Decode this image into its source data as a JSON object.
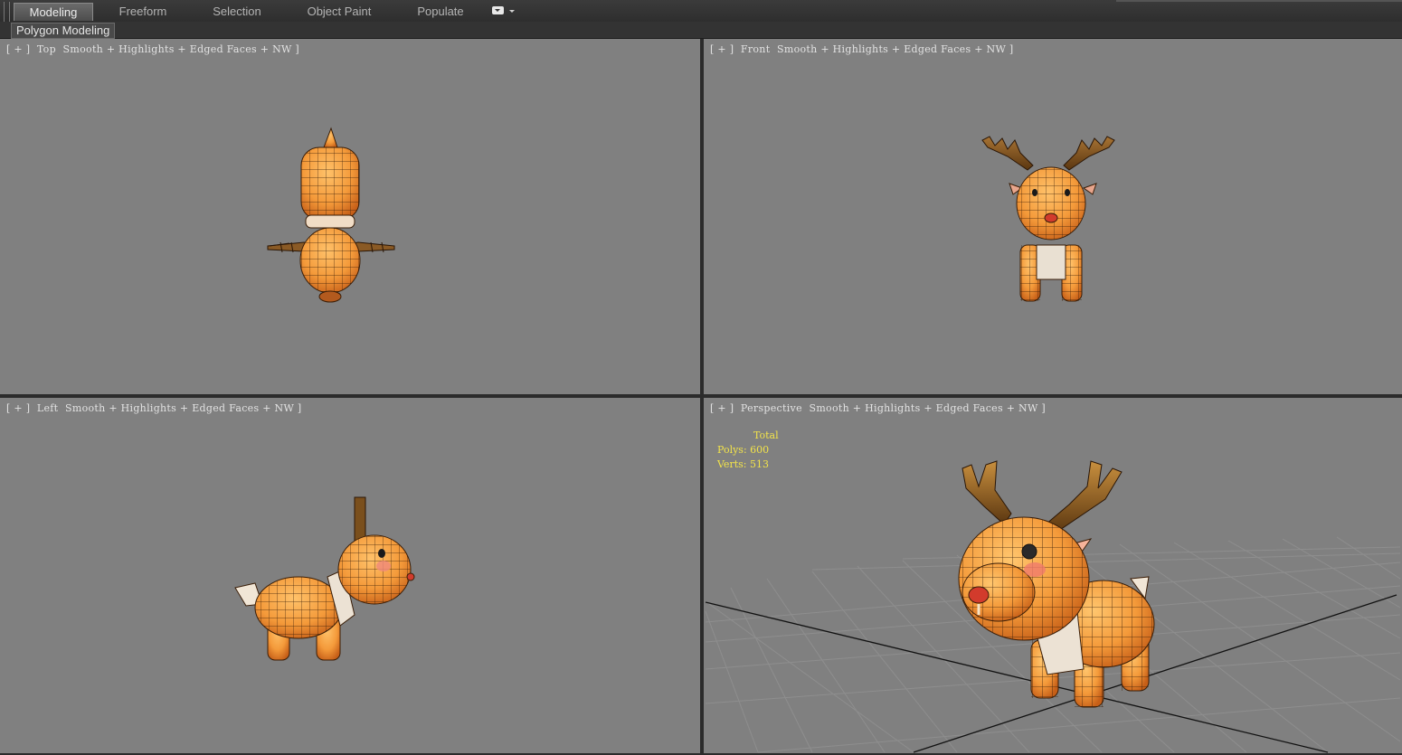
{
  "ribbon": {
    "tabs": [
      {
        "label": "Modeling",
        "active": true
      },
      {
        "label": "Freeform",
        "active": false
      },
      {
        "label": "Selection",
        "active": false
      },
      {
        "label": "Object Paint",
        "active": false
      },
      {
        "label": "Populate",
        "active": false
      }
    ]
  },
  "subribbon": {
    "panel_label": "Polygon Modeling"
  },
  "viewports": {
    "top": {
      "plus": "[ + ]",
      "view": "Top",
      "shading": "Smooth + Highlights + Edged Faces + NW ]"
    },
    "front": {
      "plus": "[ + ]",
      "view": "Front",
      "shading": "Smooth + Highlights + Edged Faces + NW ]"
    },
    "left": {
      "plus": "[ + ]",
      "view": "Left",
      "shading": "Smooth + Highlights + Edged Faces + NW ]"
    },
    "perspective": {
      "plus": "[ + ]",
      "view": "Perspective",
      "shading": "Smooth + Highlights + Edged Faces + NW ]",
      "stats": {
        "total_label": "Total",
        "polys": "Polys: 600",
        "verts": "Verts: 513"
      }
    }
  },
  "colors": {
    "viewport_bg": "#808080",
    "body_orange": "#f29a3c",
    "antler_brown": "#7a4f1c",
    "stats_yellow": "#f2e34a"
  }
}
